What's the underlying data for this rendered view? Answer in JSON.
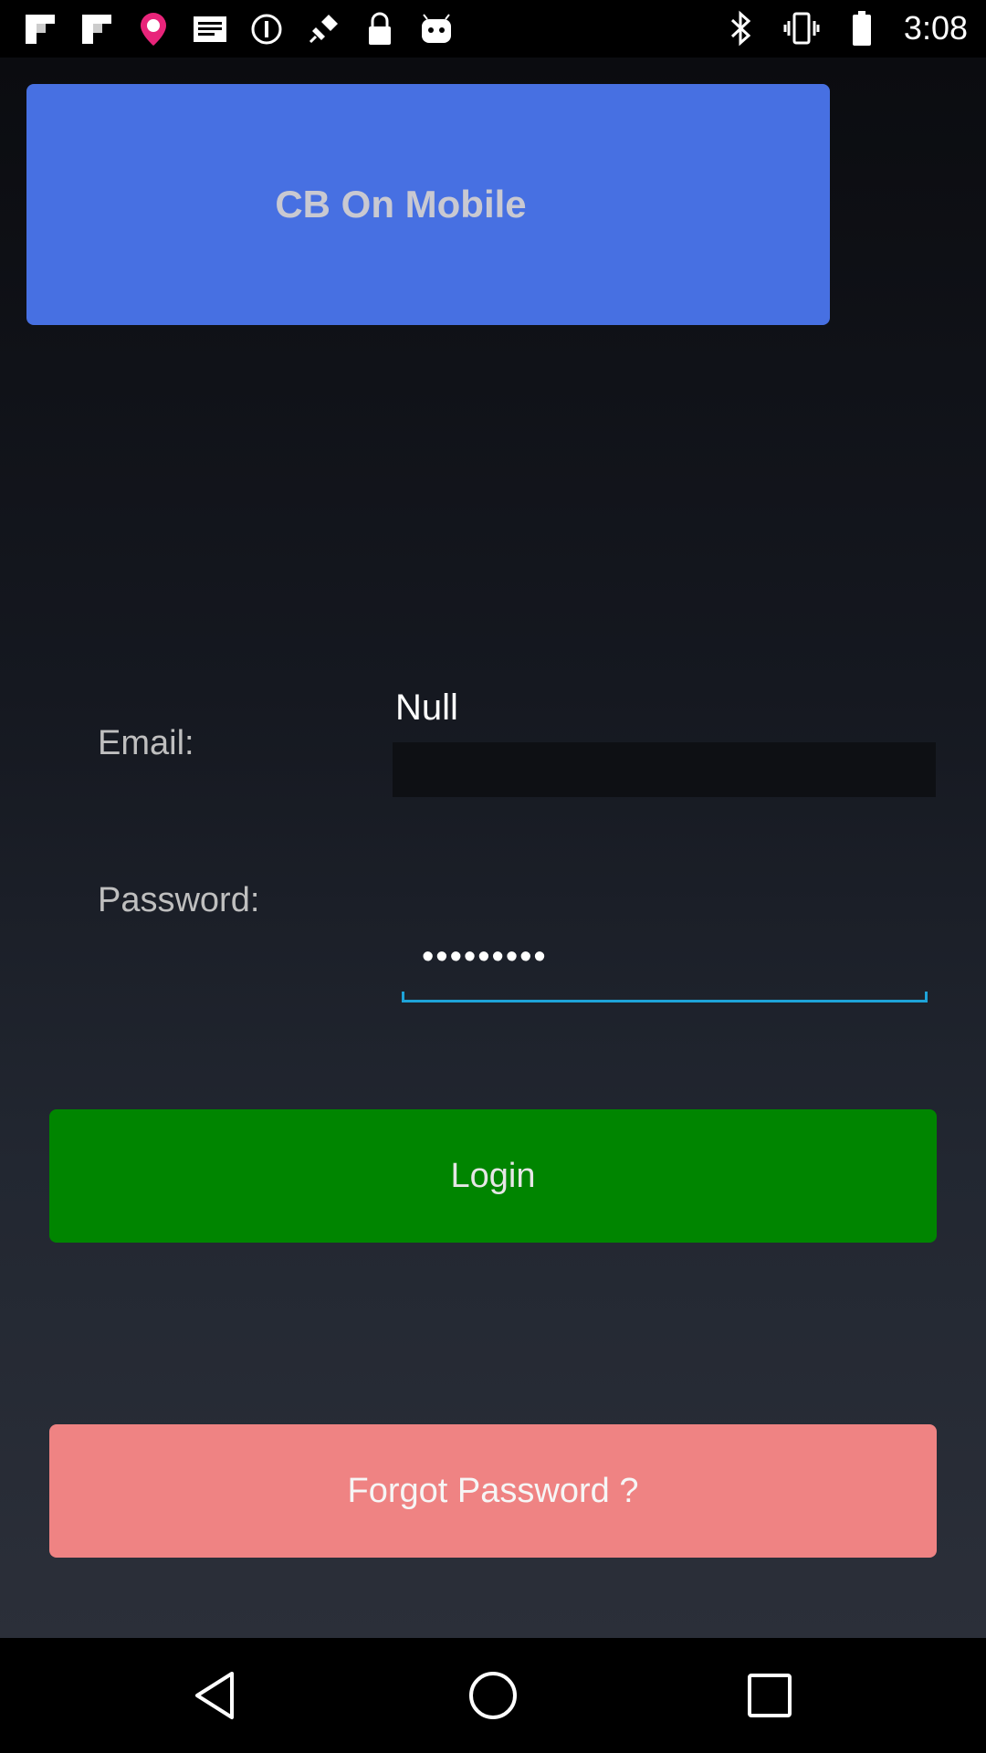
{
  "status_bar": {
    "left_icons": [
      "flipboard-icon",
      "flipboard-icon",
      "location-pin-icon",
      "message-icon",
      "signal-off-icon",
      "fake-gps-icon",
      "lock-icon",
      "android-icon"
    ],
    "right_icons": [
      "bluetooth-icon",
      "vibrate-icon",
      "battery-icon"
    ],
    "time": "3:08"
  },
  "header": {
    "title": "CB On Mobile",
    "background": "#4770e2"
  },
  "form": {
    "email_label": "Email:",
    "email_value": "Null",
    "password_label": "Password:",
    "password_value": "•••••••••"
  },
  "buttons": {
    "login_label": "Login",
    "login_color": "#008500",
    "forgot_label": "Forgot Password ?",
    "forgot_color": "#ef8383"
  },
  "nav_bar": {
    "icons": [
      "back-icon",
      "home-icon",
      "recent-apps-icon"
    ]
  }
}
